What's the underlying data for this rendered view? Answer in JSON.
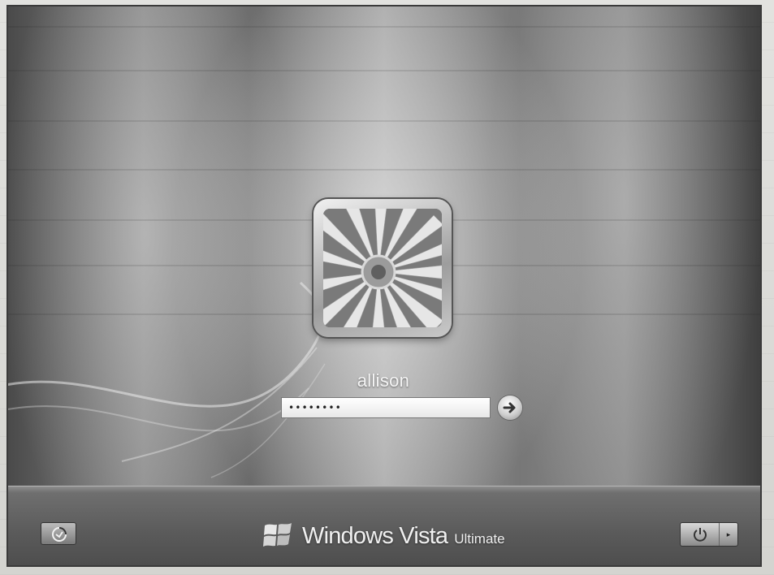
{
  "login": {
    "username": "allison",
    "password_value": "••••••••"
  },
  "branding": {
    "product_name": "Windows Vista",
    "edition": "Ultimate",
    "logo_icon": "windows-flag-icon"
  },
  "bottom_bar": {
    "left_icon": "ease-of-access-icon",
    "submit_icon": "arrow-right-icon",
    "power_icon": "power-icon",
    "power_menu_icon": "chevron-right-icon"
  },
  "colors": {
    "screen_background": "#5c5c5c",
    "text": "#f4f4f4"
  }
}
